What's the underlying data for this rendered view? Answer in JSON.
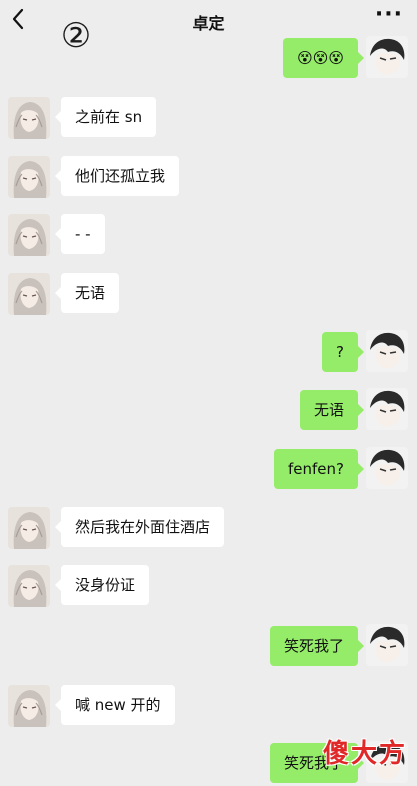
{
  "header": {
    "title": "卓定",
    "circled_number": "②",
    "more_label": "···"
  },
  "messages": [
    {
      "from": "me",
      "text": "😵😵😵"
    },
    {
      "from": "them",
      "text": "之前在 sn"
    },
    {
      "from": "them",
      "text": "他们还孤立我"
    },
    {
      "from": "them",
      "text": "- -"
    },
    {
      "from": "them",
      "text": "无语"
    },
    {
      "from": "me",
      "text": "?"
    },
    {
      "from": "me",
      "text": "无语"
    },
    {
      "from": "me",
      "text": "fenfen?"
    },
    {
      "from": "them",
      "text": "然后我在外面住酒店"
    },
    {
      "from": "them",
      "text": "没身份证"
    },
    {
      "from": "me",
      "text": "笑死我了"
    },
    {
      "from": "them",
      "text": "喊 new 开的"
    },
    {
      "from": "me",
      "text": "笑死我了"
    }
  ],
  "watermark": "傻大方",
  "colors": {
    "background": "#ededed",
    "incoming_bubble": "#ffffff",
    "outgoing_bubble": "#95ec69"
  }
}
